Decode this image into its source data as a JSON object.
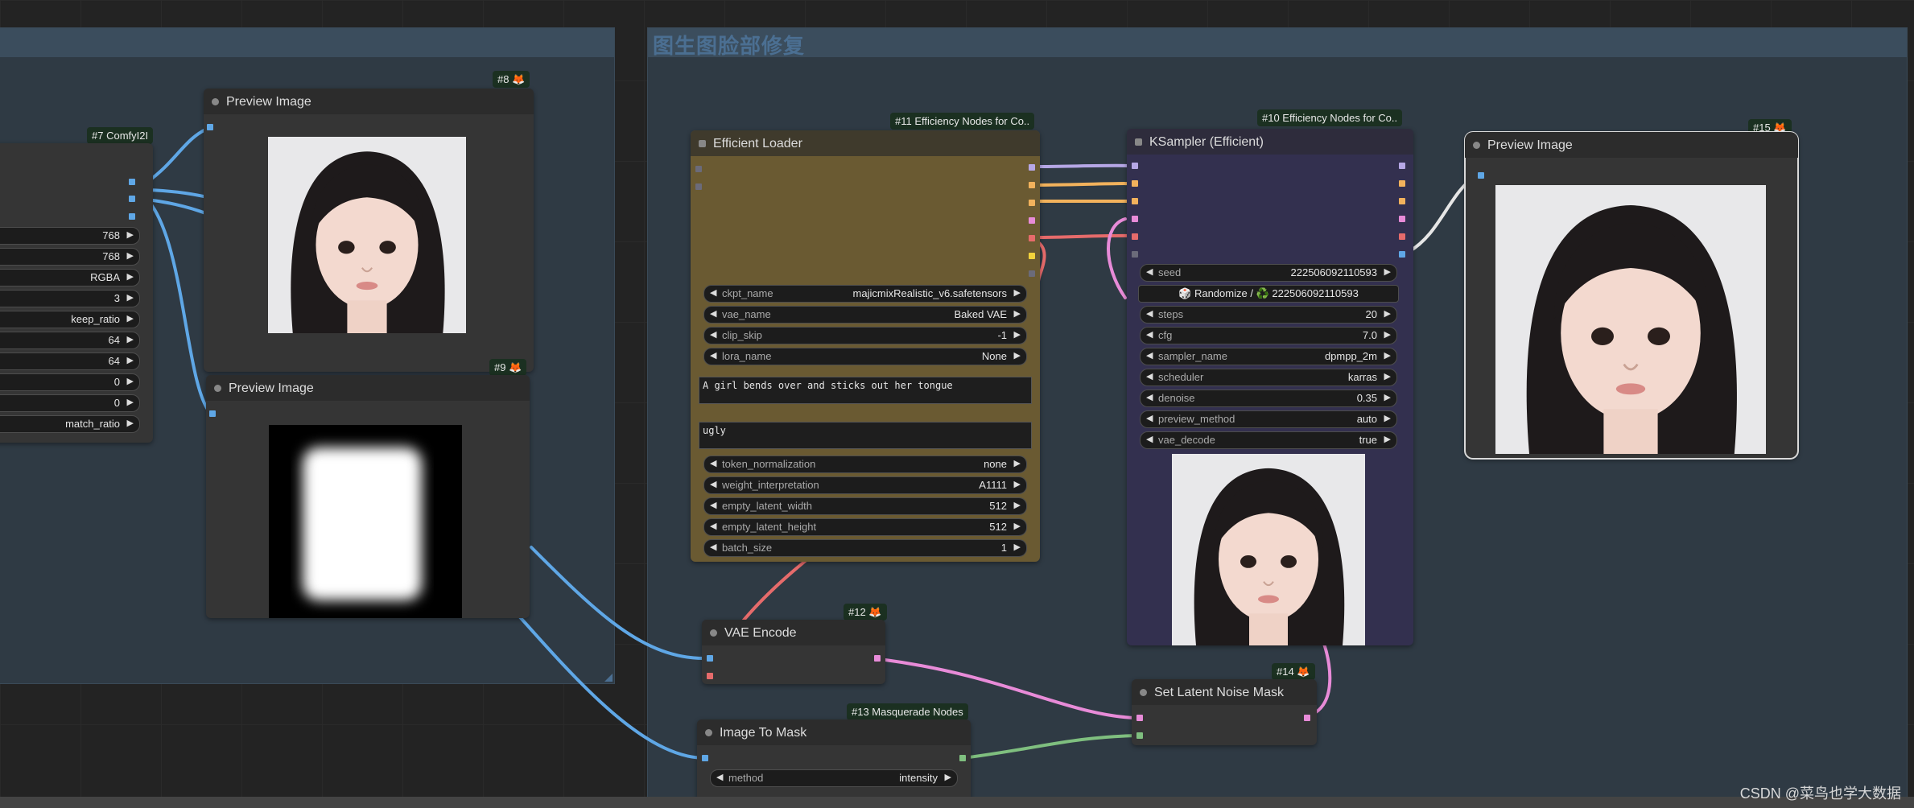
{
  "group": {
    "title": "图生图脸部修复"
  },
  "colors": {
    "image_wire": "#5fa7e6",
    "latent_wire": "#e88bd8",
    "mask_wire": "#7fbf7f",
    "model_wire": "#b6a7e6",
    "clip_wire": "#f2b25c",
    "vae_wire": "#e66b6b"
  },
  "nodes": {
    "n7": {
      "badge": "#7 ComfyI2I",
      "widgets": [
        "768",
        "768",
        "RGBA",
        "3",
        "keep_ratio",
        "64",
        "64",
        "0",
        "0",
        "match_ratio"
      ]
    },
    "n8": {
      "badge": "#8 🦊",
      "title": "Preview Image"
    },
    "n9": {
      "badge": "#9 🦊",
      "title": "Preview Image"
    },
    "n11": {
      "badge": "#11 Efficiency Nodes for Co..",
      "title": "Efficient Loader",
      "widgets": [
        {
          "label": "ckpt_name",
          "value": "majicmixRealistic_v6.safetensors"
        },
        {
          "label": "vae_name",
          "value": "Baked VAE"
        },
        {
          "label": "clip_skip",
          "value": "-1"
        },
        {
          "label": "lora_name",
          "value": "None"
        }
      ],
      "positive": "A girl bends over and sticks out her tongue",
      "negative": "ugly",
      "widgets2": [
        {
          "label": "token_normalization",
          "value": "none"
        },
        {
          "label": "weight_interpretation",
          "value": "A1111"
        },
        {
          "label": "empty_latent_width",
          "value": "512"
        },
        {
          "label": "empty_latent_height",
          "value": "512"
        },
        {
          "label": "batch_size",
          "value": "1"
        }
      ]
    },
    "n10": {
      "badge": "#10 Efficiency Nodes for Co..",
      "title": "KSampler (Efficient)",
      "seed": {
        "label": "seed",
        "value": "222506092110593"
      },
      "randomize": "🎲 Randomize / ♻️ 222506092110593",
      "widgets": [
        {
          "label": "steps",
          "value": "20"
        },
        {
          "label": "cfg",
          "value": "7.0"
        },
        {
          "label": "sampler_name",
          "value": "dpmpp_2m"
        },
        {
          "label": "scheduler",
          "value": "karras"
        },
        {
          "label": "denoise",
          "value": "0.35"
        },
        {
          "label": "preview_method",
          "value": "auto"
        },
        {
          "label": "vae_decode",
          "value": "true"
        }
      ]
    },
    "n15": {
      "badge": "#15 🦊",
      "title": "Preview Image"
    },
    "n12": {
      "badge": "#12 🦊",
      "title": "VAE Encode"
    },
    "n13": {
      "badge": "#13 Masquerade Nodes",
      "title": "Image To Mask",
      "widget": {
        "label": "method",
        "value": "intensity"
      }
    },
    "n14": {
      "badge": "#14 🦊",
      "title": "Set Latent Noise Mask"
    }
  },
  "watermark": "CSDN @菜鸟也学大数据"
}
